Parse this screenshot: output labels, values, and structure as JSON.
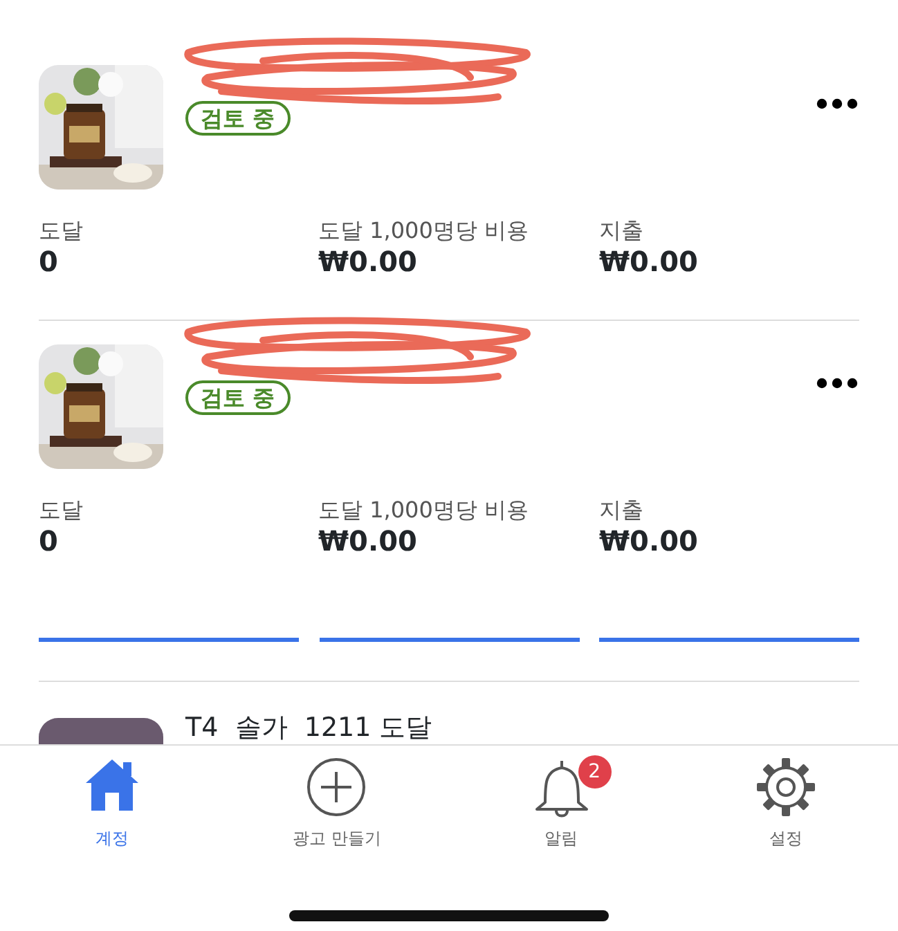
{
  "ads": [
    {
      "title_scribbled": true,
      "status": "검토 중",
      "loading": false,
      "metrics": [
        {
          "label": "도달",
          "value": "0"
        },
        {
          "label": "도달 1,000명당 비용",
          "value": "₩0.00"
        },
        {
          "label": "지출",
          "value": "₩0.00"
        }
      ]
    },
    {
      "title_scribbled": true,
      "status": "검토 중",
      "loading": true,
      "metrics": [
        {
          "label": "도달",
          "value": "0"
        },
        {
          "label": "도달 1,000명당 비용",
          "value": "₩0.00"
        },
        {
          "label": "지출",
          "value": "₩0.00"
        }
      ]
    }
  ],
  "partial_ad": {
    "title": "T4  솔가  1211 도달"
  },
  "tabs": [
    {
      "kind": "home",
      "label": "계정",
      "selected": true
    },
    {
      "kind": "create",
      "label": "광고 만들기",
      "selected": false
    },
    {
      "kind": "alerts",
      "label": "알림",
      "selected": false,
      "badge": "2"
    },
    {
      "kind": "settings",
      "label": "설정",
      "selected": false
    }
  ]
}
